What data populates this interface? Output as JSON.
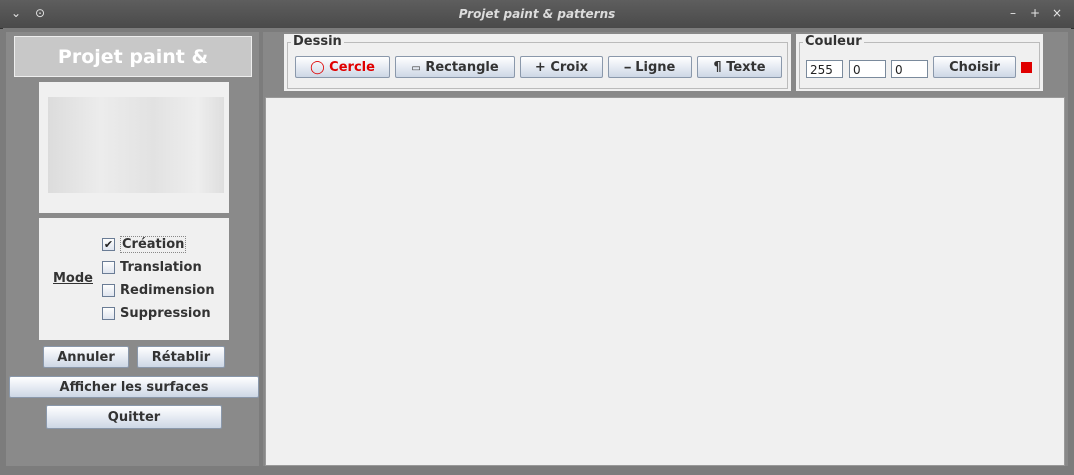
{
  "window": {
    "title": "Projet paint & patterns"
  },
  "titlebar": {
    "menu_icon": "chevron-down",
    "pin_icon": "circle-pin",
    "minimize": "–",
    "maximize": "+",
    "close": "×"
  },
  "sidebar": {
    "title": "Projet paint & patterns",
    "mode_label": "Mode",
    "modes": [
      {
        "label": "Création",
        "checked": true
      },
      {
        "label": "Translation",
        "checked": false
      },
      {
        "label": "Redimension",
        "checked": false
      },
      {
        "label": "Suppression",
        "checked": false
      }
    ],
    "undo_label": "Annuler",
    "redo_label": "Rétablir",
    "show_surfaces_label": "Afficher les surfaces",
    "quit_label": "Quitter"
  },
  "dessin": {
    "group_label": "Dessin",
    "buttons": [
      {
        "icon": "◯",
        "label": "Cercle",
        "color": "#e00000"
      },
      {
        "icon": "▭",
        "label": "Rectangle",
        "color": "#333333"
      },
      {
        "icon": "+",
        "label": "Croix",
        "color": "#333333"
      },
      {
        "icon": "━",
        "label": "Ligne",
        "color": "#333333"
      },
      {
        "icon": "¶",
        "label": "Texte",
        "color": "#333333"
      }
    ]
  },
  "couleur": {
    "group_label": "Couleur",
    "r": "255",
    "g": "0",
    "b": "0",
    "choose_label": "Choisir",
    "swatch_color": "#e00000"
  }
}
